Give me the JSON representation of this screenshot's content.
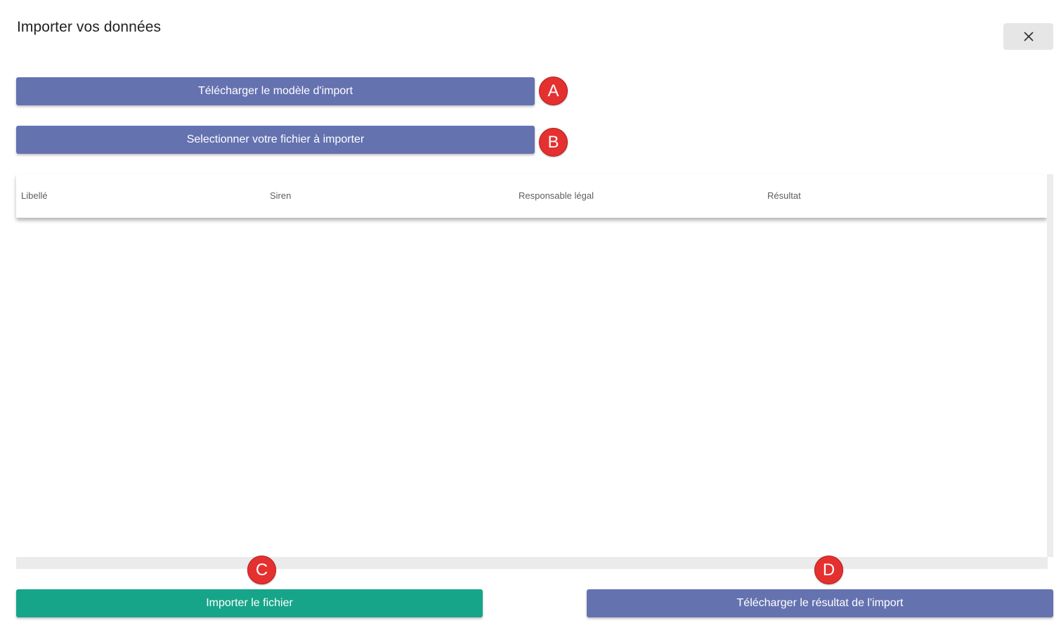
{
  "dialog": {
    "title": "Importer vos données",
    "close_icon": "close-icon"
  },
  "buttons": {
    "download_template": "Télécharger le modèle d'import",
    "select_file": "Selectionner votre fichier à importer",
    "import_file": "Importer le fichier",
    "download_result": "Télécharger le résultat de l'import"
  },
  "markers": {
    "a": "A",
    "b": "B",
    "c": "C",
    "d": "D"
  },
  "table": {
    "columns": [
      "Libellé",
      "Siren",
      "Responsable légal",
      "Résultat"
    ]
  },
  "colors": {
    "primary": "#6572b0",
    "success": "#17a589",
    "marker": "#e53030"
  }
}
